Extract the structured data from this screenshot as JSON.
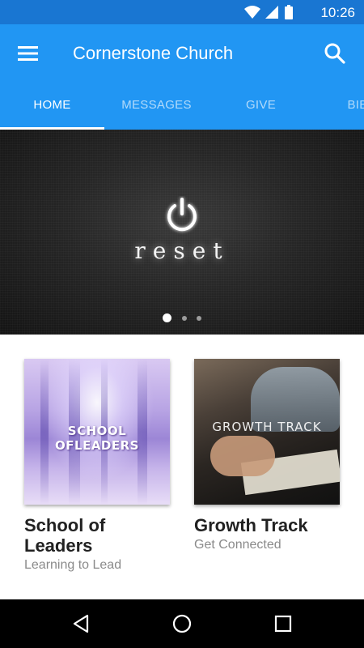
{
  "status_bar": {
    "time": "10:26",
    "icons": [
      "wifi-icon",
      "signal-icon",
      "battery-icon"
    ],
    "color": "#1976D2"
  },
  "app_bar": {
    "title": "Cornerstone Church",
    "menu_icon": "menu-icon",
    "search_icon": "search-icon",
    "color": "#2196F3"
  },
  "tabs": [
    {
      "label": "HOME",
      "active": true
    },
    {
      "label": "MESSAGES",
      "active": false
    },
    {
      "label": "GIVE",
      "active": false
    },
    {
      "label": "BIBLE",
      "active": false
    }
  ],
  "hero": {
    "word": "reset",
    "icon": "power-icon",
    "slide_index": 1,
    "slide_count": 3
  },
  "cards": [
    {
      "thumb_text": "SCHOOL OFLEADERS",
      "title": "School of Leaders",
      "subtitle": "Learning to Lead"
    },
    {
      "thumb_text": "GROWTH TRACK",
      "title": "Growth Track",
      "subtitle": "Get Connected"
    }
  ],
  "nav_bar": {
    "buttons": [
      "back-icon",
      "home-icon",
      "recents-icon"
    ]
  }
}
